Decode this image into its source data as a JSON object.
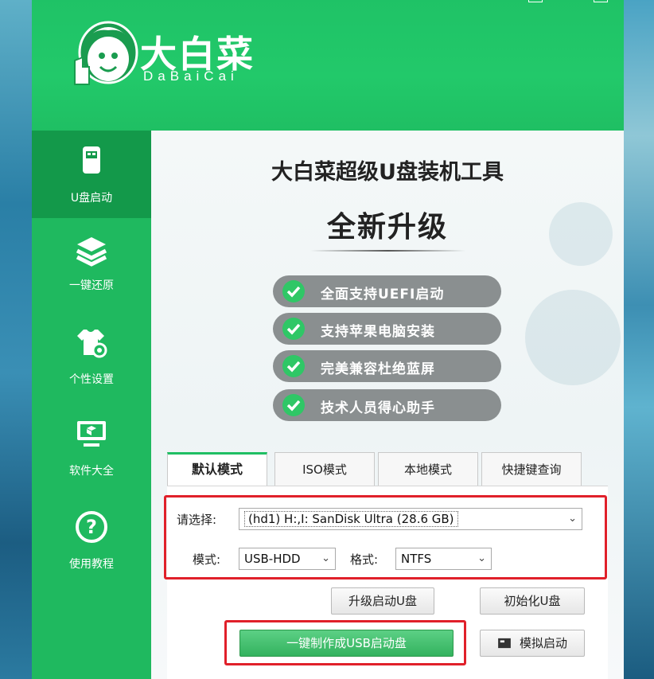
{
  "brand": {
    "name_cn": "大白菜",
    "name_en": "DaBaiCai"
  },
  "sidebar": {
    "items": [
      {
        "label": "U盘启动",
        "icon": "usb-drive-icon",
        "active": true
      },
      {
        "label": "一键还原",
        "icon": "layers-icon",
        "active": false
      },
      {
        "label": "个性设置",
        "icon": "shirt-gear-icon",
        "active": false
      },
      {
        "label": "软件大全",
        "icon": "monitor-box-icon",
        "active": false
      },
      {
        "label": "使用教程",
        "icon": "question-icon",
        "active": false
      }
    ]
  },
  "banner": {
    "title": "大白菜超级U盘装机工具",
    "subtitle": "全新升级",
    "features": [
      "全面支持UEFI启动",
      "支持苹果电脑安装",
      "完美兼容杜绝蓝屏",
      "技术人员得心助手"
    ]
  },
  "tabs": [
    "默认模式",
    "ISO模式",
    "本地模式",
    "快捷键查询"
  ],
  "form": {
    "select_label": "请选择:",
    "disk_value": "(hd1) H:,I: SanDisk Ultra (28.6 GB)",
    "mode_label": "模式:",
    "mode_value": "USB-HDD",
    "format_label": "格式:",
    "format_value": "NTFS"
  },
  "buttons": {
    "upgrade": "升级启动U盘",
    "init": "初始化U盘",
    "make": "一键制作成USB启动盘",
    "simulate": "模拟启动"
  },
  "colors": {
    "brand_green": "#1fbf63",
    "highlight_red": "#e0202a",
    "check_green": "#2fc766"
  }
}
